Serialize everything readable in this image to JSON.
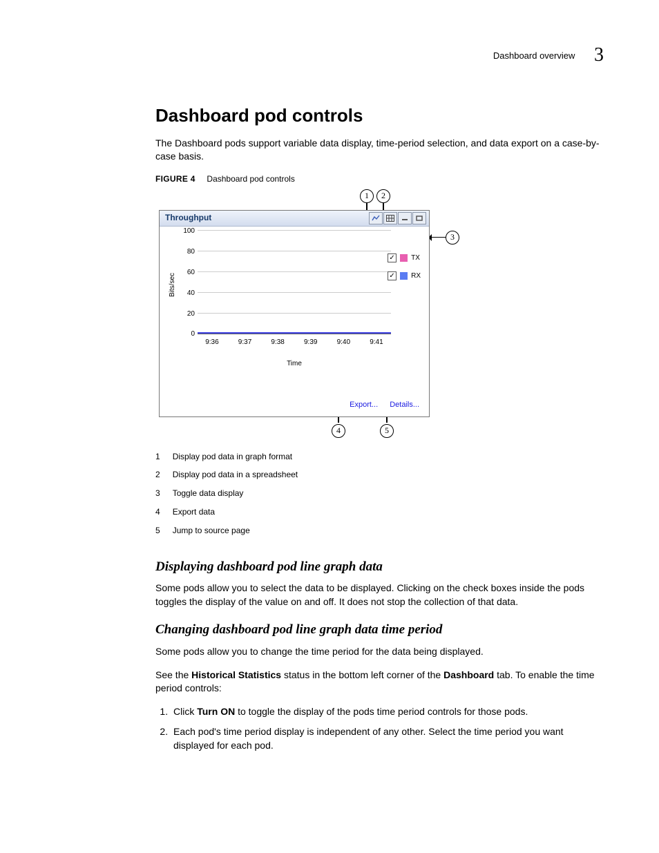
{
  "header": {
    "breadcrumb": "Dashboard overview",
    "chapter": "3"
  },
  "h1": "Dashboard pod controls",
  "intro": "The Dashboard pods support variable data display, time-period selection, and data export on a case-by-case basis.",
  "figure": {
    "label": "FIGURE 4",
    "caption": "Dashboard pod controls",
    "pod_title": "Throughput",
    "links": {
      "export": "Export...",
      "details": "Details..."
    },
    "legend": [
      {
        "label": "TX",
        "color": "#e85fb0"
      },
      {
        "label": "RX",
        "color": "#5a7cf2"
      }
    ],
    "callouts": {
      "1": "1",
      "2": "2",
      "3": "3",
      "4": "4",
      "5": "5"
    }
  },
  "chart_data": {
    "type": "line",
    "title": "Throughput",
    "xlabel": "Time",
    "ylabel": "Bits/sec",
    "ylim": [
      0,
      100
    ],
    "yticks": [
      0,
      20,
      40,
      60,
      80,
      100
    ],
    "categories": [
      "9:36",
      "9:37",
      "9:38",
      "9:39",
      "9:40",
      "9:41"
    ],
    "series": [
      {
        "name": "TX",
        "values": [
          0,
          0,
          0,
          0,
          0,
          0
        ]
      },
      {
        "name": "RX",
        "values": [
          0,
          0,
          0,
          0,
          0,
          0
        ]
      }
    ]
  },
  "legend_list": [
    {
      "n": "1",
      "text": "Display pod data in graph format"
    },
    {
      "n": "2",
      "text": "Display pod data in a spreadsheet"
    },
    {
      "n": "3",
      "text": "Toggle data display"
    },
    {
      "n": "4",
      "text": "Export data"
    },
    {
      "n": "5",
      "text": "Jump to source page"
    }
  ],
  "section1": {
    "title": "Displaying dashboard pod line graph data",
    "p": "Some pods allow you to select the data to be displayed. Clicking on the check boxes inside the pods toggles the display of the value on and off. It does not stop the collection of that data."
  },
  "section2": {
    "title": "Changing dashboard pod line graph data time period",
    "p1": "Some pods allow you to change the time period for the data being displayed.",
    "p2a": "See the ",
    "p2b": "Historical Statistics",
    "p2c": " status in the bottom left corner of the ",
    "p2d": "Dashboard",
    "p2e": " tab. To enable the time period controls:",
    "step1a": "Click ",
    "step1b": "Turn ON",
    "step1c": " to toggle the display of the pods time period controls for those pods.",
    "step2": "Each pod's time period display is independent of any other. Select the time period you want displayed for each pod."
  }
}
